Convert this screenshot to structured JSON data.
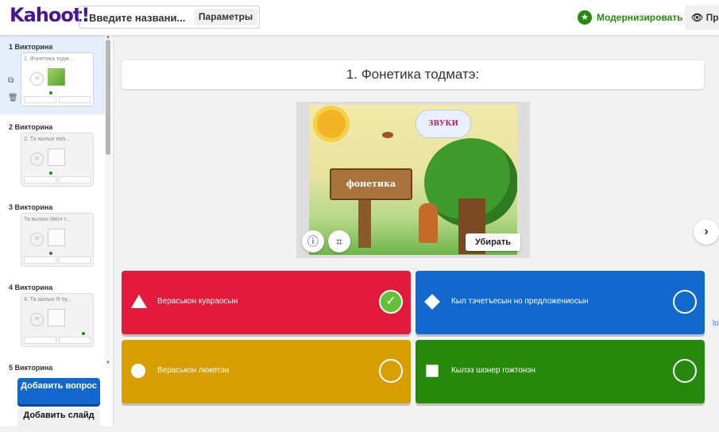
{
  "app": {
    "logo": "Kahoot!"
  },
  "header": {
    "title_placeholder": "Введите названи...",
    "params_label": "Параметры",
    "upgrade_label": "Модернизировать",
    "preview_label": "Пре"
  },
  "sidebar": {
    "slides": [
      {
        "header": "1  Викторина",
        "title": "1. Фонетика тодм...",
        "active": true,
        "has_image": true
      },
      {
        "header": "2  Викторина",
        "title": "2. Та кылын неб...",
        "active": false,
        "has_image": false
      },
      {
        "header": "3  Викторина",
        "title": "Та кылын öвöл т...",
        "active": false,
        "has_image": false
      },
      {
        "header": "4  Викторина",
        "title": "4. Та кылын Я бу...",
        "active": false,
        "has_image": false
      },
      {
        "header": "5  Викторина",
        "title": "",
        "active": false,
        "has_image": false
      }
    ],
    "add_question": "Добавить вопрос",
    "add_slide": "Добавить слайд"
  },
  "question": {
    "title": "1. Фонетика тодматэ:"
  },
  "media": {
    "image_texts": {
      "cloud": "ЗВУКИ",
      "sign": "фонетика"
    },
    "remove_label": "Убирать"
  },
  "answers": [
    {
      "text": "Вераськон куараосын",
      "color": "#e21b3c",
      "shape": "triangle",
      "correct": true
    },
    {
      "text": "Кыл тэчетъесын но предложениосын",
      "color": "#1368ce",
      "shape": "diamond",
      "correct": false
    },
    {
      "text": "Вераськон люкетэн",
      "color": "#d89e00",
      "shape": "circle",
      "correct": false
    },
    {
      "text": "Кылэз шонер гожтонэн",
      "color": "#26890c",
      "shape": "square",
      "correct": false
    }
  ],
  "edge_text": "lo"
}
